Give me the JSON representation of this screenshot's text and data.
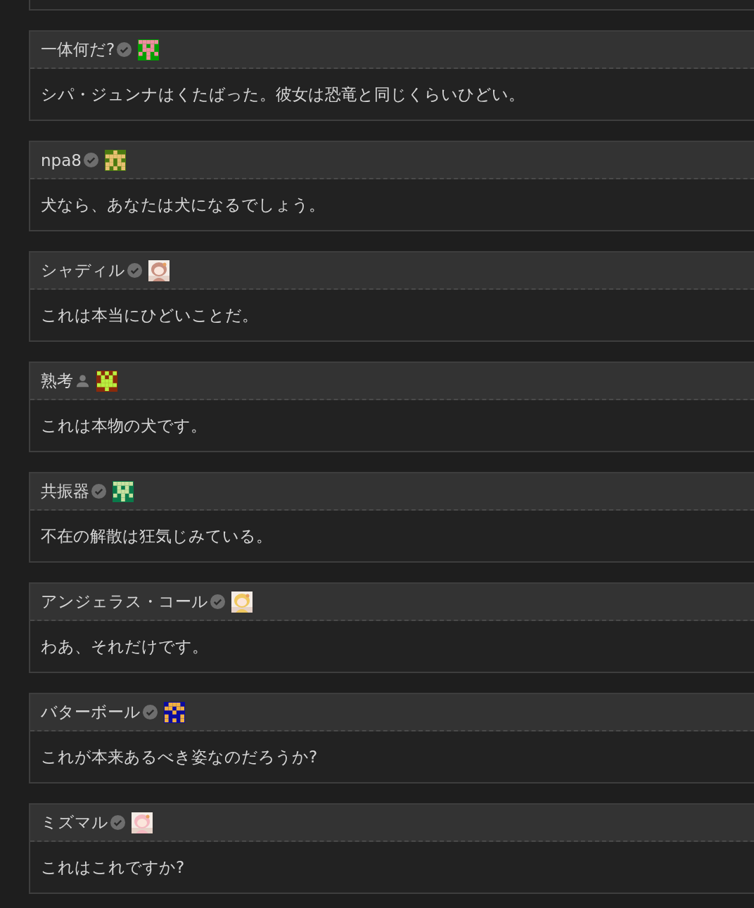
{
  "messages": [
    {
      "author": "一体何だ?",
      "verified": true,
      "avatar": {
        "kind": "identicon",
        "color": "#00a000"
      },
      "text": "シパ・ジュンナはくたばった。彼女は恐竜と同じくらいひどい。"
    },
    {
      "author": "npa8",
      "verified": true,
      "avatar": {
        "kind": "identicon",
        "color": "#4b7a10"
      },
      "text": "犬なら、あなたは犬になるでしょう。"
    },
    {
      "author": "シャディル",
      "verified": true,
      "text": "これは本当にひどいことだ。"
    },
    {
      "author": "熟考",
      "verified": false,
      "avatar": {
        "kind": "identicon",
        "color": "#8b2a0a"
      },
      "text": "これは本物の犬です。"
    },
    {
      "author": "共振器",
      "verified": true,
      "avatar": {
        "kind": "identicon",
        "color": "#0a7a4a"
      },
      "text": "不在の解散は狂気じみている。"
    },
    {
      "author": "アンジェラス・コール",
      "verified": true,
      "text": "わあ、それだけです。"
    },
    {
      "author": "バターボール",
      "verified": true,
      "avatar": {
        "kind": "identicon",
        "color": "#0a0aa0"
      },
      "text": "これが本来あるべき姿なのだろうか?"
    },
    {
      "author": "ミズマル",
      "verified": true,
      "text": "これはこれですか?"
    }
  ]
}
